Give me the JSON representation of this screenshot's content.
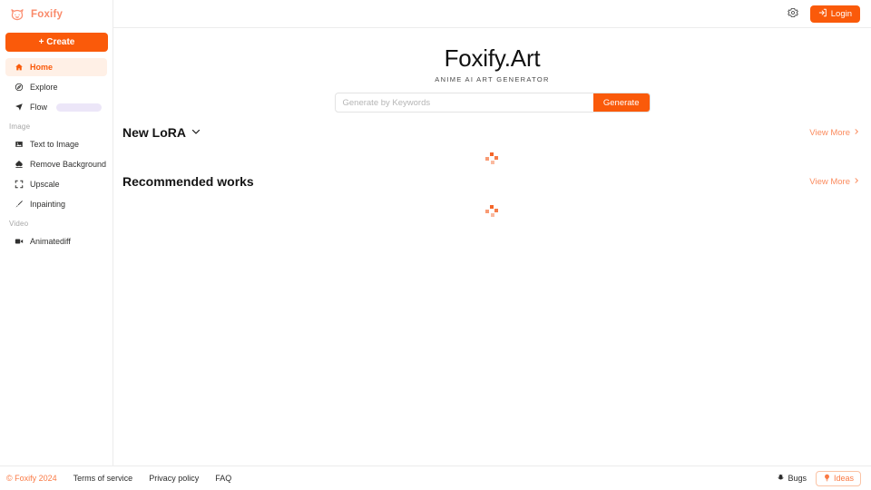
{
  "brand": {
    "name": "Foxify",
    "logo_icon": "fox-head-icon"
  },
  "sidebar": {
    "create_label": "+ Create",
    "items": [
      {
        "label": "Home",
        "icon": "home-icon",
        "active": true
      },
      {
        "label": "Explore",
        "icon": "compass-icon",
        "active": false
      },
      {
        "label": "Flow",
        "icon": "flow-icon",
        "active": false,
        "badge_skeleton": true
      }
    ],
    "groups": [
      {
        "label": "Image",
        "items": [
          {
            "label": "Text to Image",
            "icon": "image-icon"
          },
          {
            "label": "Remove Background",
            "icon": "eraser-icon"
          },
          {
            "label": "Upscale",
            "icon": "expand-icon"
          },
          {
            "label": "Inpainting",
            "icon": "brush-icon"
          }
        ]
      },
      {
        "label": "Video",
        "items": [
          {
            "label": "Animatediff",
            "icon": "video-icon"
          }
        ]
      }
    ]
  },
  "topbar": {
    "settings_icon": "gear-icon",
    "login_label": "Login",
    "login_icon": "login-icon"
  },
  "hero": {
    "title": "Foxify.Art",
    "subtitle": "ANIME AI ART GENERATOR"
  },
  "search": {
    "placeholder": "Generate by Keywords",
    "value": "",
    "button_label": "Generate"
  },
  "sections": [
    {
      "title": "New LoRA",
      "has_chevron": true,
      "view_more_label": "View More",
      "state": "loading"
    },
    {
      "title": "Recommended works",
      "has_chevron": false,
      "view_more_label": "View More",
      "state": "loading"
    }
  ],
  "footer": {
    "copyright": "© Foxify 2024",
    "links": [
      {
        "label": "Terms of service"
      },
      {
        "label": "Privacy policy"
      },
      {
        "label": "FAQ"
      }
    ],
    "bugs_label": "Bugs",
    "bugs_icon": "bug-icon",
    "ideas_label": "Ideas",
    "ideas_icon": "lightbulb-icon"
  },
  "colors": {
    "accent": "#fa5a0a",
    "accent_soft": "#fb8c5f",
    "accent_bg": "#fff0e6",
    "badge_purple": "#ece6f8",
    "border": "#ececec"
  }
}
